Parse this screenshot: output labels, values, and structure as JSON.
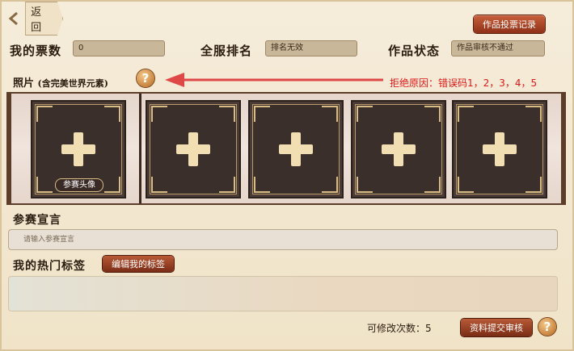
{
  "header": {
    "back_label": "返回",
    "vote_record_label": "作品投票记录"
  },
  "stats": {
    "my_votes_label": "我的票数",
    "my_votes_value": "0",
    "rank_label": "全服排名",
    "rank_value": "排名无效",
    "status_label": "作品状态",
    "status_value": "作品审核不通过"
  },
  "photos": {
    "title": "照片",
    "subtitle": "(含完美世界元素)",
    "help_icon": "?",
    "reject_reason": "拒绝原因：错误码1，2，3，4，5",
    "avatar_tag": "参赛头像",
    "slots": [
      "add-photo",
      "add-photo",
      "add-photo",
      "add-photo",
      "add-photo"
    ]
  },
  "declaration": {
    "title": "参赛宣言",
    "placeholder": "请输入参赛宣言"
  },
  "tags": {
    "title": "我的热门标签",
    "edit_label": "编辑我的标签"
  },
  "footer": {
    "edits_remaining": "可修改次数：5",
    "submit_label": "资料提交审核",
    "help_icon": "?"
  },
  "colors": {
    "accent": "#8e3018",
    "reject_text": "#e01818",
    "panel": "#f0e3c8"
  }
}
